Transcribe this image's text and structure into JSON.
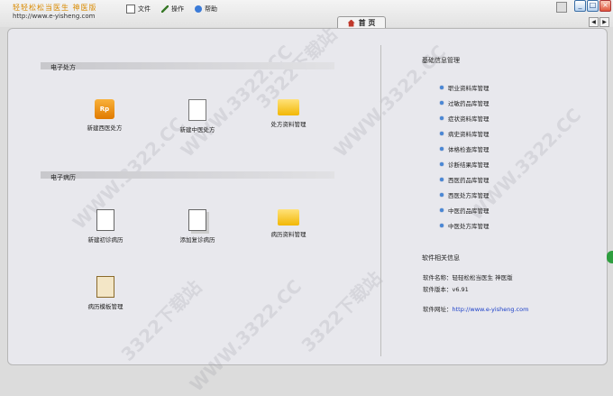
{
  "app": {
    "logo_text": "轻轻松松当医生 神医版",
    "url": "http://www.e-yisheng.com"
  },
  "menu": [
    {
      "label": "文件",
      "icon": "file-icon"
    },
    {
      "label": "操作",
      "icon": "pencil-icon"
    },
    {
      "label": "帮助",
      "icon": "help-icon"
    }
  ],
  "tab": {
    "label": "首 页"
  },
  "window": {
    "min": "_",
    "max": "□",
    "close": "×",
    "prev": "◀",
    "next": "▶"
  },
  "sections": {
    "prescription": {
      "title": "电子处方",
      "items": [
        {
          "label": "新建西医处方",
          "icon": "rp-prescription-icon"
        },
        {
          "label": "新建中医处方",
          "icon": "document-pen-icon"
        },
        {
          "label": "处方资料管理",
          "icon": "folder-icon"
        }
      ]
    },
    "records": {
      "title": "电子病历",
      "items": [
        {
          "label": "新建初诊病历",
          "icon": "document-icon"
        },
        {
          "label": "添加复诊病历",
          "icon": "documents-icon"
        },
        {
          "label": "病历资料管理",
          "icon": "folder-icon"
        },
        {
          "label": "病历模板管理",
          "icon": "clipboard-icon"
        }
      ]
    }
  },
  "basic_info": {
    "title": "基础信息管理",
    "items": [
      "职业资料库管理",
      "过敏药品库管理",
      "症状资料库管理",
      "病史资料库管理",
      "体格检查库管理",
      "诊断结果库管理",
      "西医药品库管理",
      "西医处方库管理",
      "中医药品库管理",
      "中医处方库管理"
    ]
  },
  "software_info": {
    "title": "软件相关信息",
    "name_label": "软件名称：",
    "name_value": "轻轻松松当医生 神医版",
    "version_label": "软件版本：",
    "version_value": "v6.91",
    "site_label": "软件网址：",
    "site_value": "http://www.e-yisheng.com"
  },
  "watermark": {
    "a": "3322下载站",
    "b": "WWW.3322.CC"
  }
}
